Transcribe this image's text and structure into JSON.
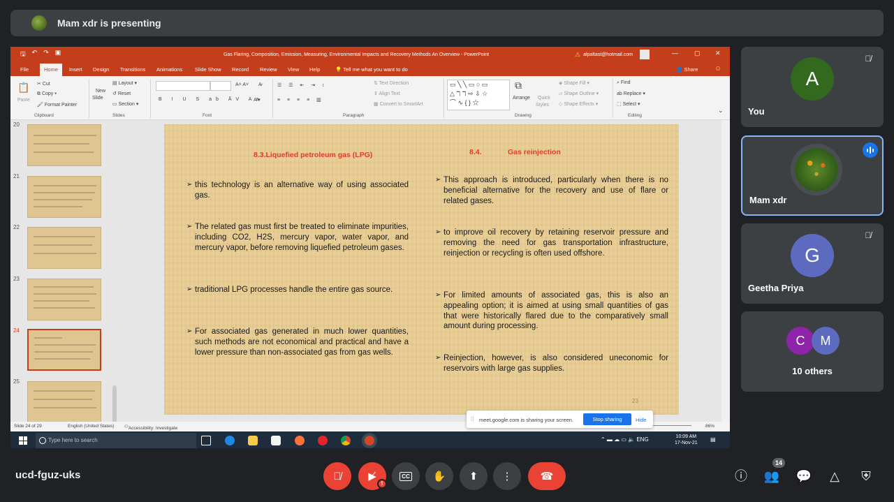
{
  "banner": {
    "text": "Mam xdr is presenting"
  },
  "powerpoint": {
    "window_title": "Gas Flaring, Composition, Emission, Measuring, Environmental Impacts and Recovery Methods An Overview - PowerPoint",
    "account": "alpaltast@hotmail.com",
    "tabs": [
      "File",
      "Home",
      "Insert",
      "Design",
      "Transitions",
      "Animations",
      "Slide Show",
      "Record",
      "Review",
      "View",
      "Help"
    ],
    "active_tab": "Home",
    "tell_me": "Tell me what you want to do",
    "share": "Share",
    "ribbon": {
      "paste": "Paste",
      "cut": "Cut",
      "copy": "Copy",
      "format_painter": "Format Painter",
      "clipboard": "Clipboard",
      "new_slide_1": "New",
      "new_slide_2": "Slide",
      "layout": "Layout",
      "reset": "Reset",
      "section": "Section",
      "slides": "Slides",
      "font": "Font",
      "text_direction": "Text Direction",
      "align_text": "Align Text",
      "convert_smartart": "Convert to SmartArt",
      "paragraph": "Paragraph",
      "arrange": "Arrange",
      "quick_styles_1": "Quick",
      "quick_styles_2": "Styles",
      "shape_fill": "Shape Fill",
      "shape_outline": "Shape Outline",
      "shape_effects": "Shape Effects",
      "drawing": "Drawing",
      "find": "Find",
      "replace": "Replace",
      "select": "Select",
      "editing": "Editing"
    },
    "thumbnails": [
      "20",
      "21",
      "22",
      "23",
      "24",
      "25"
    ],
    "selected_thumbnail": "24",
    "slide": {
      "left_heading": "8.3.Liquefied petroleum gas (LPG)",
      "right_heading_num": "8.4.",
      "right_heading": "Gas reinjection",
      "left_bullets": [
        "this technology is an alternative way of using associated gas.",
        "The related gas must first be treated to eliminate impurities, including CO2, H2S, mercury vapor, water vapor, and mercury vapor, before removing liquefied petroleum gases.",
        "traditional LPG processes handle the entire gas source.",
        "For associated gas generated in much lower quantities, such methods are not economical and practical and have a lower pressure than non-associated gas from gas wells."
      ],
      "right_bullets": [
        "This approach is introduced, particularly when there is no beneficial alternative for the recovery and use of flare or related gases.",
        "to improve oil recovery by retaining reservoir pressure and removing the need for gas transportation infrastructure, reinjection or recycling is often used offshore.",
        "For limited amounts of associated gas, this is also an appealing option; it is aimed at using small quantities of gas that were historically flared due to the comparatively small amount during processing.",
        "Reinjection, however, is also considered uneconomic for reservoirs with large gas supplies."
      ],
      "page_number": "23"
    },
    "status": {
      "slide_of": "Slide 24 of 29",
      "language": "English (United States)",
      "accessibility": "Accessibility: Investigate",
      "zoom": "86%"
    }
  },
  "share_bar": {
    "message": "meet.google.com is sharing your screen.",
    "stop": "Stop sharing",
    "hide": "Hide"
  },
  "taskbar": {
    "search_placeholder": "Type here to search",
    "language": "ENG",
    "time": "10:09 AM",
    "date": "17-Nov-21"
  },
  "participants": [
    {
      "initial": "A",
      "name": "You",
      "color": "#33691e",
      "muted": true
    },
    {
      "initial": "",
      "name": "Mam xdr",
      "speaking": true
    },
    {
      "initial": "G",
      "name": "Geetha Priya",
      "color": "#5c6bc0",
      "muted": true
    },
    {
      "initials": [
        "C",
        "M"
      ],
      "name": "10 others",
      "colors": [
        "#8e24aa",
        "#5c6bc0"
      ]
    }
  ],
  "meeting": {
    "code": "ucd-fguz-uks",
    "people_count": "14"
  },
  "icons": {
    "mic": "mic-off-icon",
    "camera": "camera-off-icon",
    "captions": "captions-icon",
    "hand": "raise-hand-icon",
    "present": "present-icon",
    "more": "more-vert-icon",
    "hangup": "call-end-icon",
    "info": "info-icon",
    "people": "people-icon",
    "chat": "chat-icon",
    "activities": "activities-icon",
    "safety": "host-controls-icon"
  }
}
